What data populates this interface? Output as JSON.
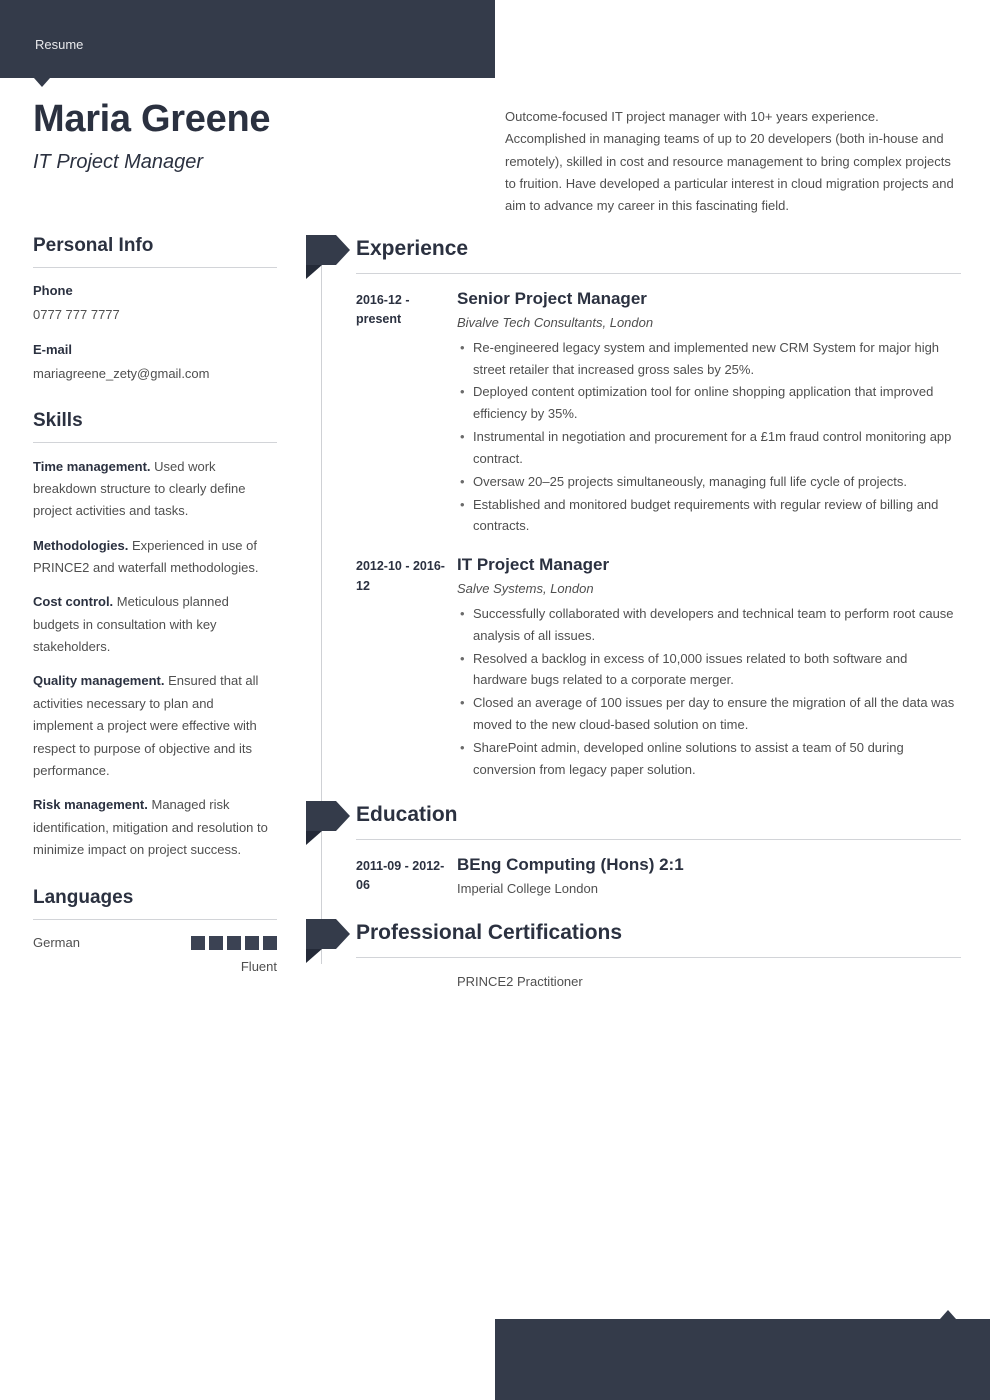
{
  "document": {
    "label": "Resume",
    "accent_dark": "#343b4a",
    "accent_fold": "#242a38",
    "rule_color": "#d2d4d8"
  },
  "header": {
    "name": "Maria Greene",
    "title": "IT Project Manager",
    "summary": "Outcome-focused IT project manager with 10+ years experience. Accomplished in managing teams of up to 20 developers (both in-house and remotely), skilled in cost and resource management to bring complex projects to fruition. Have developed a particular interest in cloud migration projects and aim to advance my career in this fascinating field."
  },
  "sidebar": {
    "personal_info": {
      "heading": "Personal Info",
      "fields": [
        {
          "label": "Phone",
          "value": "0777 777 7777"
        },
        {
          "label": "E-mail",
          "value": "mariagreene_zety@gmail.com"
        }
      ]
    },
    "skills": {
      "heading": "Skills",
      "items": [
        {
          "name": "Time management.",
          "description": " Used work breakdown structure to clearly define project activities and tasks."
        },
        {
          "name": "Methodologies.",
          "description": " Experienced in use of PRINCE2 and waterfall methodologies."
        },
        {
          "name": "Cost control.",
          "description": " Meticulous planned budgets in consultation with key stakeholders."
        },
        {
          "name": "Quality management.",
          "description": " Ensured that all activities necessary to plan and implement a project were effective with respect to purpose of objective and its performance."
        },
        {
          "name": "Risk management.",
          "description": " Managed risk identification, mitigation and resolution to minimize impact on project success."
        }
      ]
    },
    "languages": {
      "heading": "Languages",
      "items": [
        {
          "name": "German",
          "level_label": "Fluent",
          "rating": 5,
          "max_rating": 5
        }
      ]
    }
  },
  "main": {
    "experience": {
      "heading": "Experience",
      "entries": [
        {
          "date": "2016-12 - present",
          "title": "Senior Project Manager",
          "subtitle": "Bivalve Tech Consultants, London",
          "bullets": [
            "Re-engineered legacy system and implemented new CRM System for major high street retailer that increased gross sales by 25%.",
            "Deployed content optimization tool for online shopping application that improved efficiency by 35%.",
            "Instrumental in negotiation and procurement for a £1m fraud control monitoring app contract.",
            "Oversaw 20–25 projects simultaneously, managing full life cycle of projects.",
            "Established and monitored budget requirements with regular review of billing and contracts."
          ]
        },
        {
          "date": "2012-10 - 2016-12",
          "title": "IT Project Manager",
          "subtitle": "Salve Systems, London",
          "bullets": [
            "Successfully collaborated with developers and technical team to perform root cause analysis of all issues.",
            "Resolved a backlog in excess of 10,000 issues related to both software and hardware bugs related to a corporate merger.",
            "Closed an average of 100 issues per day to ensure the migration of all the data was moved to the new cloud-based solution on time.",
            "SharePoint admin, developed online solutions to assist a team of 50 during conversion from legacy paper solution."
          ]
        }
      ]
    },
    "education": {
      "heading": "Education",
      "entries": [
        {
          "date": "2011-09 - 2012-06",
          "title": "BEng Computing (Hons) 2:1",
          "subtitle": "Imperial College London"
        }
      ]
    },
    "certifications": {
      "heading": "Professional Certifications",
      "entries": [
        {
          "date": "",
          "title": "PRINCE2 Practitioner"
        }
      ]
    }
  }
}
